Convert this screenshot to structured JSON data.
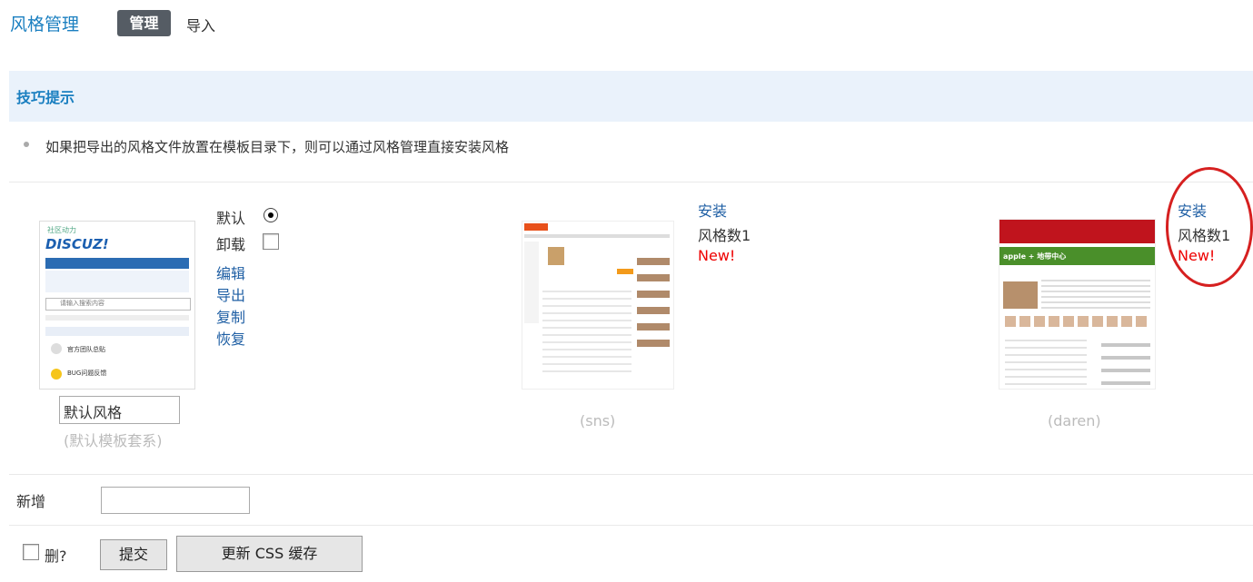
{
  "header": {
    "title": "风格管理",
    "tabs": [
      {
        "label": "管理",
        "active": true
      },
      {
        "label": "导入",
        "active": false
      }
    ]
  },
  "tips": {
    "title": "技巧提示",
    "items": [
      "如果把导出的风格文件放置在模板目录下，则可以通过风格管理直接安装风格"
    ]
  },
  "styles": [
    {
      "name_value": "默认风格",
      "subtitle": "(默认模板套系)",
      "default_label": "默认",
      "uninstall_label": "卸载",
      "actions": [
        "编辑",
        "导出",
        "复制",
        "恢复"
      ],
      "thumb_text": {
        "brand": "DISCUZ!",
        "tagline": "社区动力",
        "search_placeholder": "请输入搜索内容",
        "forum1": "官方团队总贴",
        "forum2": "BUG问题反馈"
      }
    },
    {
      "install": "安装",
      "count": "风格数1",
      "new": "New!",
      "subtitle": "(sns)"
    },
    {
      "install": "安装",
      "count": "风格数1",
      "new": "New!",
      "subtitle": "(daren)",
      "thumb_text": {
        "brand": "apple + 地带中心"
      }
    }
  ],
  "form": {
    "new_label": "新增",
    "new_value": "",
    "delete_label": "删?",
    "submit": "提交",
    "refresh_css": "更新 CSS 缓存"
  },
  "colors": {
    "link": "#1f5fa4",
    "accent": "#1a7fc0",
    "new": "#ee0000",
    "highlight_circle": "#d62020"
  }
}
